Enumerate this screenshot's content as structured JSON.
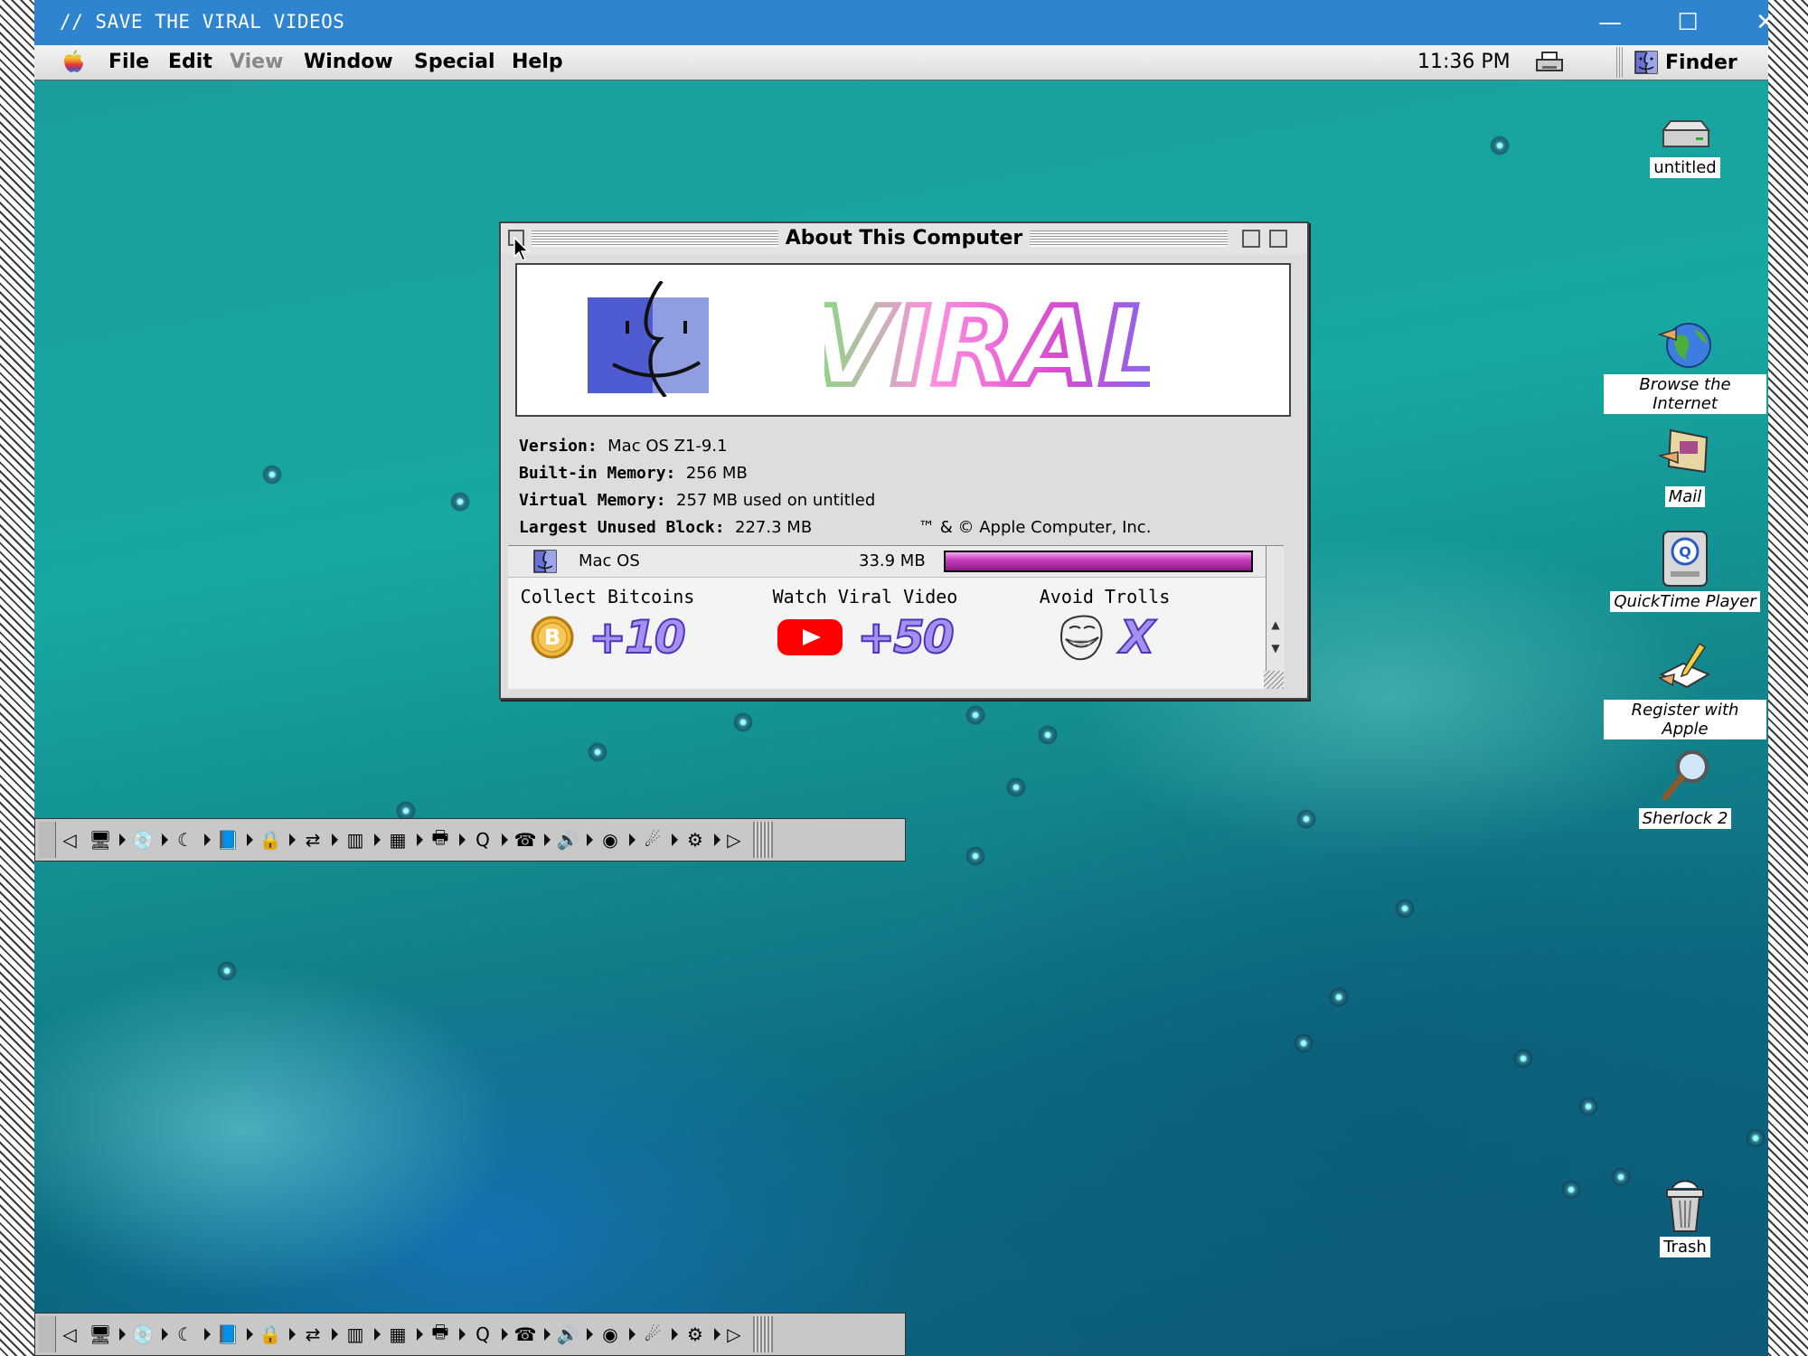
{
  "host_window": {
    "title": "// SAVE THE VIRAL VIDEOS",
    "minimize": "—",
    "maximize": "☐",
    "close": "✕"
  },
  "menubar": {
    "items": [
      "File",
      "Edit",
      "View",
      "Window",
      "Special",
      "Help"
    ],
    "disabled_item": "View",
    "clock": "11:36 PM",
    "active_app": "Finder"
  },
  "about_window": {
    "title": "About This Computer",
    "banner_logo_text": "VIRAL",
    "info": {
      "version_label": "Version:",
      "version_value": "Mac OS Z1-9.1",
      "builtin_label": "Built-in Memory:",
      "builtin_value": "256 MB",
      "virtual_label": "Virtual Memory:",
      "virtual_value": "257 MB used on untitled",
      "block_label": "Largest Unused Block:",
      "block_value": "227.3 MB",
      "copyright": "™ & © Apple Computer, Inc."
    },
    "memory_list": [
      {
        "name": "Mac OS",
        "size": "33.9 MB",
        "usage_fraction": 1.0
      }
    ],
    "game": {
      "bitcoin_label": "Collect Bitcoins",
      "bitcoin_score": "+10",
      "video_label": "Watch Viral Video",
      "video_score": "+50",
      "troll_label": "Avoid Trolls",
      "troll_score": "X"
    }
  },
  "desktop_icons": [
    {
      "label": "untitled",
      "icon": "hard-disk-icon"
    },
    {
      "label": "Browse the Internet",
      "icon": "internet-globe-icon"
    },
    {
      "label": "Mail",
      "icon": "mail-icon"
    },
    {
      "label": "QuickTime Player",
      "icon": "quicktime-icon"
    },
    {
      "label": "Register with Apple",
      "icon": "register-icon"
    },
    {
      "label": "Sherlock 2",
      "icon": "sherlock-icon"
    },
    {
      "label": "Trash",
      "icon": "trash-icon"
    }
  ],
  "control_strip_items": [
    "monitor-icon",
    "cd-icon",
    "sleep-icon",
    "file-sharing-icon",
    "lock-icon",
    "location-icon",
    "color-depth-icon",
    "resolution-icon",
    "printer-icon",
    "quicktime-icon",
    "remote-access-icon",
    "sound-volume-icon",
    "speech-icon",
    "energy-icon",
    "web-sharing-icon"
  ],
  "colors": {
    "host_titlebar": "#2f84cf",
    "desktop_teal": "#17a8a2",
    "usage_bar": "#c93fc0",
    "score_text": "#a78ff0"
  }
}
